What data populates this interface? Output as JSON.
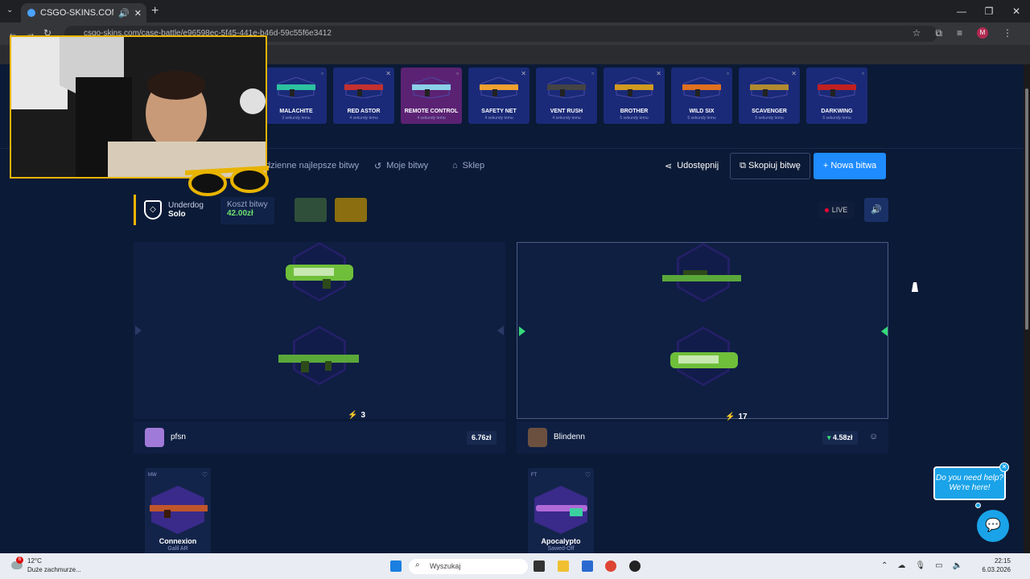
{
  "browser": {
    "tab_title": "CSGO-SKINS.COM - Najlep",
    "url": "csgo-skins.com/case-battle/e96598ec-5f45-441e-b46d-59c55f6e3412",
    "profile_initial": "M"
  },
  "cases": [
    {
      "name": "MALACHITE",
      "time": "3 sekundy temu"
    },
    {
      "name": "RED ASTOR",
      "time": "4 sekundy temu"
    },
    {
      "name": "REMOTE CONTROL",
      "time": "4 sekundy temu"
    },
    {
      "name": "SAFETY NET",
      "time": "4 sekundy temu"
    },
    {
      "name": "VENT RUSH",
      "time": "4 sekundy temu"
    },
    {
      "name": "BROTHER",
      "time": "5 sekundy temu"
    },
    {
      "name": "WILD SIX",
      "time": "5 sekundy temu"
    },
    {
      "name": "SCAVENGER",
      "time": "5 sekundy temu"
    },
    {
      "name": "DARKWING",
      "time": "6 sekundy temu"
    }
  ],
  "toolbar": {
    "daily_best": "dzienne najlepsze bitwy",
    "my_battles": "Moje bitwy",
    "shop": "Sklep",
    "share": "Udostępnij",
    "copy": "Skopiuj bitwę",
    "new": "Nowa bitwa"
  },
  "battle": {
    "mode_title": "Underdog",
    "mode_sub": "Solo",
    "cost_label": "Koszt bitwy",
    "cost_value": "42.00zł",
    "live": "LIVE"
  },
  "players": [
    {
      "name": "pfsn",
      "value": "6.76zł",
      "count": "3",
      "drop": {
        "cond": "MW",
        "name": "Connexion",
        "weapon": "Galil AR"
      }
    },
    {
      "name": "Blindenn",
      "value": "4.58zł",
      "count": "17",
      "drop": {
        "cond": "FT",
        "name": "Apocalypto",
        "weapon": "Sawed-Off"
      }
    }
  ],
  "help": {
    "line1": "Do you need help?",
    "line2": "We're here!"
  },
  "taskbar": {
    "temp": "12°C",
    "weather": "Duże zachmurze...",
    "search": "Wyszukaj",
    "time": "22:15",
    "date": "6.03.2026",
    "notif": "6"
  },
  "colors": {
    "accent": "#1e8bff",
    "live_dot": "#e03",
    "gold": "#f5b400",
    "money": "#6ee06e"
  }
}
